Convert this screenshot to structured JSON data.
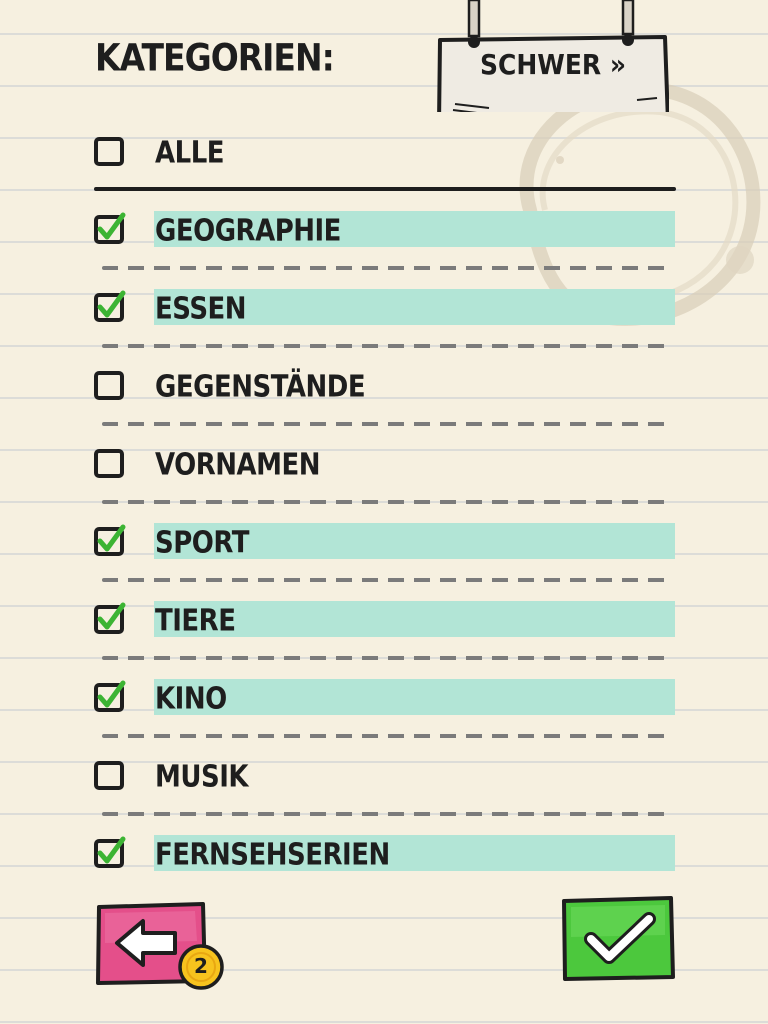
{
  "header": {
    "title": "KATEGORIEN:"
  },
  "difficulty": {
    "label": "SCHWER »"
  },
  "all_option": {
    "label": "ALLE",
    "checked": false
  },
  "categories": [
    {
      "label": "GEOGRAPHIE",
      "checked": true
    },
    {
      "label": "ESSEN",
      "checked": true
    },
    {
      "label": "GEGENSTÄNDE",
      "checked": false
    },
    {
      "label": "VORNAMEN",
      "checked": false
    },
    {
      "label": "SPORT",
      "checked": true
    },
    {
      "label": "TIERE",
      "checked": true
    },
    {
      "label": "KINO",
      "checked": true
    },
    {
      "label": "MUSIK",
      "checked": false
    },
    {
      "label": "FERNSEHSERIEN",
      "checked": true
    }
  ],
  "back_button": {
    "icon": "arrow-left-icon",
    "coin_count": "2"
  },
  "confirm_button": {
    "icon": "checkmark-icon"
  },
  "colors": {
    "paper": "#f6f0e0",
    "line": "#dcdcd8",
    "highlight": "#b2e5d6",
    "check_green": "#3cb433",
    "back_pink": "#e44f8a",
    "ok_green": "#4cc83d",
    "coin_yellow": "#f7c31e"
  }
}
